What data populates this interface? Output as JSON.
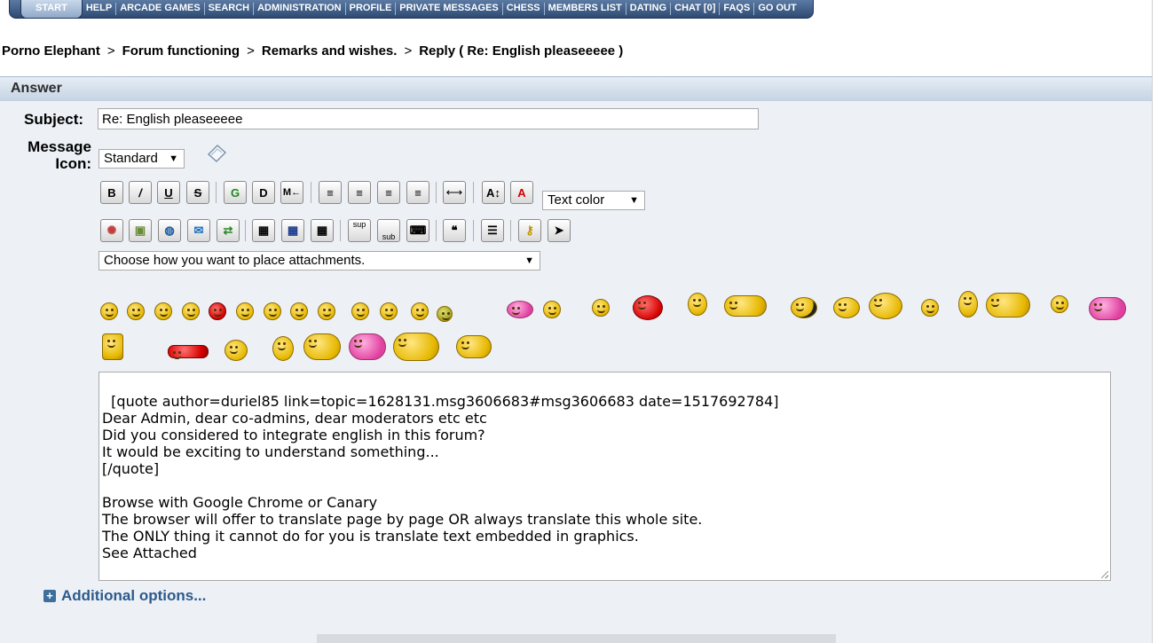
{
  "nav": {
    "items": [
      "START",
      "HELP",
      "ARCADE GAMES",
      "SEARCH",
      "ADMINISTRATION",
      "PROFILE",
      "PRIVATE MESSAGES",
      "CHESS",
      "MEMBERS LIST",
      "DATING",
      "CHAT [0]",
      "FAQS",
      "GO OUT"
    ]
  },
  "breadcrumb": {
    "items": [
      "Porno Elephant",
      "Forum functioning",
      "Remarks and wishes.",
      "Reply ( Re: English pleaseeeee )"
    ],
    "separator": ">"
  },
  "section": {
    "title": "Answer"
  },
  "form": {
    "subject_label": "Subject:",
    "subject_value": "Re: English pleaseeeee",
    "message_label_1": "Message",
    "message_label_2": "Icon:",
    "icon_select": "Standard",
    "text_color": "Text color",
    "attachments_select": "Choose how you want to place attachments.",
    "body": "[quote author=duriel85 link=topic=1628131.msg3606683#msg3606683 date=1517692784]\nDear Admin, dear co-admins, dear moderators etc etc\nDid you considered to integrate english in this forum?\nIt would be exciting to understand something...\n[/quote]\n\nBrowse with Google Chrome or Canary\nThe browser will offer to translate page by page OR always translate this whole site.\nThe ONLY thing it cannot do for you is translate text embedded in graphics.\nSee Attached\n\nGood Luck",
    "additional_options": "Additional options..."
  },
  "toolbar": {
    "row1": [
      "B",
      "I",
      "U",
      "S",
      "G",
      "D",
      "M",
      "align-left",
      "align-center",
      "align-center-2",
      "align-right",
      "hr",
      "font-size",
      "font-color"
    ],
    "row1_labels": {
      "bold": "B",
      "italic": "/",
      "underline": "U",
      "strike": "S",
      "glow": "G",
      "shadow": "D",
      "move": "M←",
      "hr": "⟷",
      "size": "A↕",
      "color": "A"
    },
    "row2_labels": {
      "sup": "sup",
      "sub": "sub"
    }
  },
  "colors": {
    "nav_bg": "#2d4a72",
    "accent": "#2c5a8c",
    "header_bg": "#c4d3e3",
    "form_bg": "#edf1f6"
  }
}
